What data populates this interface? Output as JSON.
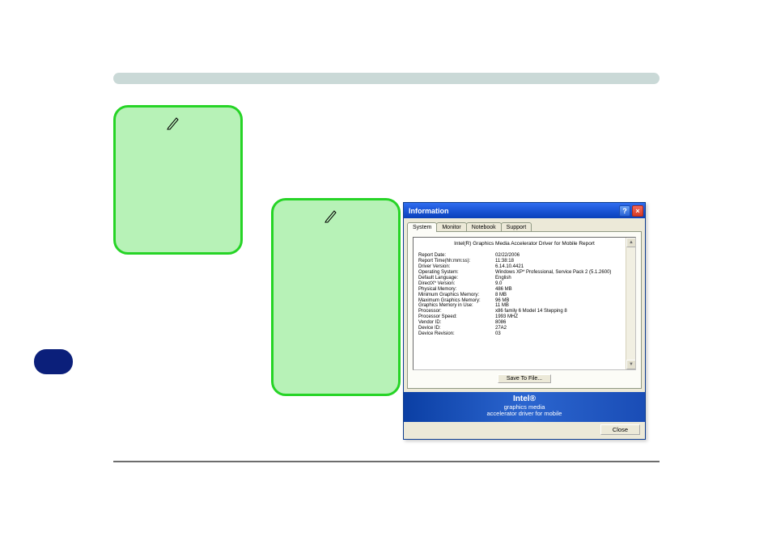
{
  "dialog": {
    "title": "Information",
    "help_glyph": "?",
    "close_glyph": "×",
    "tabs": [
      "System",
      "Monitor",
      "Notebook",
      "Support"
    ],
    "active_tab": 0,
    "report_title": "Intel(R) Graphics Media Accelerator Driver for Mobile Report",
    "rows": [
      {
        "k": "Report Date:",
        "v": "02/22/2006"
      },
      {
        "k": "Report Time(hh:mm:ss):",
        "v": "11:38:18"
      },
      {
        "k": "Driver Version:",
        "v": "6.14.10.4421"
      },
      {
        "k": "Operating System:",
        "v": "Windows XP* Professional, Service Pack 2 (5.1.2600)"
      },
      {
        "k": "Default Language:",
        "v": "English"
      },
      {
        "k": "DirectX* Version:",
        "v": "9.0"
      },
      {
        "k": "Physical Memory:",
        "v": "486 MB"
      },
      {
        "k": "Minimum Graphics Memory:",
        "v": "8 MB"
      },
      {
        "k": "Maximum Graphics Memory:",
        "v": "96 MB"
      },
      {
        "k": "Graphics Memory in Use:",
        "v": "11 MB"
      },
      {
        "k": "Processor:",
        "v": "x86 family 6 Model 14 Stepping 8"
      },
      {
        "k": "Processor Speed:",
        "v": "1993 MHZ"
      },
      {
        "k": "Vendor ID:",
        "v": "8086"
      },
      {
        "k": "Device ID:",
        "v": "27A2"
      },
      {
        "k": "Device Revision:",
        "v": "03"
      }
    ],
    "save_label": "Save To File...",
    "brand": {
      "l1": "Intel®",
      "l2": "graphics media",
      "l3": "accelerator driver for mobile"
    },
    "close_label": "Close",
    "scroll_up": "▲",
    "scroll_down": "▼"
  }
}
